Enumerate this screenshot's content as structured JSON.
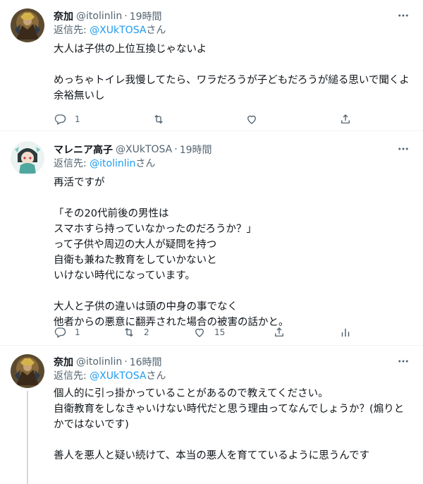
{
  "tweets": [
    {
      "name": "奈加",
      "handle": "@itolinlin",
      "time": "19時間",
      "reply_prefix": "返信先: ",
      "reply_to": "@XUkTOSA",
      "reply_suffix": "さん",
      "text": "大人は子供の上位互換じゃないよ\n\nめっちゃトイレ我慢してたら、ワラだろうが子どもだろうが縋る思いで聞くよ余裕無いし",
      "replies": "1",
      "retweets": "",
      "likes": ""
    },
    {
      "name": "マレニア高子",
      "handle": "@XUkTOSA",
      "time": "19時間",
      "reply_prefix": "返信先: ",
      "reply_to": "@itolinlin",
      "reply_suffix": "さん",
      "text": "再活ですが\n\n「その20代前後の男性は\nスマホすら持っていなかったのだろうか？」\nって子供や周辺の大人が疑問を持つ\n自衛も兼ねた教育をしていかないと\nいけない時代になっています。\n\n大人と子供の違いは頭の中身の事でなく\n他者からの悪意に翻弄された場合の被害の話かと。",
      "replies": "1",
      "retweets": "2",
      "likes": "15"
    },
    {
      "name": "奈加",
      "handle": "@itolinlin",
      "time": "16時間",
      "reply_prefix": "返信先: ",
      "reply_to": "@XUkTOSA",
      "reply_suffix": "さん",
      "text": "個人的に引っ掛かっていることがあるので教えてください。\n自衛教育をしなきゃいけない時代だと思う理由ってなんでしょうか？(煽りとかではないです)\n\n善人を悪人と疑い続けて、本当の悪人を育てているように思うんです",
      "replies": "",
      "retweets": "",
      "likes": ""
    }
  ],
  "dot": "·",
  "colors": {
    "accent": "#1d9bf0",
    "secondary_text": "#536471",
    "divider": "#eff3f4"
  },
  "icons": [
    "reply-icon",
    "retweet-icon",
    "like-icon",
    "share-icon",
    "analytics-icon",
    "more-icon"
  ]
}
